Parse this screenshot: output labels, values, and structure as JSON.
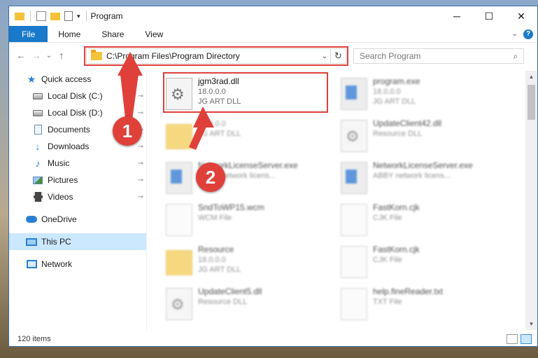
{
  "window": {
    "title": "Program",
    "controls": {
      "minimize": "─",
      "maximize": "☐",
      "close": "✕"
    }
  },
  "ribbon": {
    "tabs": [
      "File",
      "Home",
      "Share",
      "View"
    ],
    "expand_icon": "chevron-down-icon",
    "help_label": "?"
  },
  "navigation": {
    "back": "←",
    "forward": "→",
    "recent": "⌄",
    "up": "↑",
    "address": "C:\\Program Files\\Program Directory",
    "refresh": "↻",
    "dropdown": "⌄",
    "search_placeholder": "Search Program",
    "search_icon": "⌕"
  },
  "sidebar": {
    "items": [
      {
        "label": "Quick access",
        "icon": "star-icon",
        "pinned": false
      },
      {
        "label": "Local Disk (C:)",
        "icon": "disk-icon",
        "pinned": true
      },
      {
        "label": "Local Disk (D:)",
        "icon": "disk-icon",
        "pinned": true
      },
      {
        "label": "Documents",
        "icon": "documents-icon",
        "pinned": true
      },
      {
        "label": "Downloads",
        "icon": "downloads-icon",
        "pinned": true
      },
      {
        "label": "Music",
        "icon": "music-icon",
        "pinned": true
      },
      {
        "label": "Pictures",
        "icon": "pictures-icon",
        "pinned": true
      },
      {
        "label": "Videos",
        "icon": "videos-icon",
        "pinned": true
      },
      {
        "label": "OneDrive",
        "icon": "onedrive-icon",
        "pinned": false
      },
      {
        "label": "This PC",
        "icon": "this-pc-icon",
        "pinned": false,
        "selected": true
      },
      {
        "label": "Network",
        "icon": "network-icon",
        "pinned": false
      }
    ],
    "pin_glyph": "📌"
  },
  "files": [
    {
      "name": "jgm3rad.dll",
      "line2": "18.0.0.0",
      "line3": "JG ART DLL",
      "icon": "dll"
    },
    {
      "name": "program.exe",
      "line2": "18.0.0.0",
      "line3": "JG ART DLL",
      "icon": "exe"
    },
    {
      "name": "",
      "line2": "18.0.0.0",
      "line3": "JG ART DLL",
      "icon": "folder"
    },
    {
      "name": "UpdateClient42.dll",
      "line2": "Resource DLL",
      "line3": "",
      "icon": "dll"
    },
    {
      "name": "NetworkLicenseServer.exe",
      "line2": "ABBY network licens...",
      "line3": "",
      "icon": "exe"
    },
    {
      "name": "NetworkLicenseServer.exe",
      "line2": "ABBY network licens...",
      "line3": "",
      "icon": "exe"
    },
    {
      "name": "SndToWP15.wcm",
      "line2": "WCM File",
      "line3": "",
      "icon": "page"
    },
    {
      "name": "FastKorn.cjk",
      "line2": "CJK File",
      "line3": "",
      "icon": "page"
    },
    {
      "name": "Resource",
      "line2": "18.0.0.0",
      "line3": "JG ART DLL",
      "icon": "folder"
    },
    {
      "name": "FastKorn.cjk",
      "line2": "CJK File",
      "line3": "",
      "icon": "page"
    },
    {
      "name": "UpdateClient5.dll",
      "line2": "Resource DLL",
      "line3": "",
      "icon": "dll"
    },
    {
      "name": "help.fineReader.txt",
      "line2": "TXT File",
      "line3": "",
      "icon": "page"
    }
  ],
  "status": {
    "item_count": "120 items"
  },
  "callouts": {
    "step1": "1",
    "step2": "2",
    "color": "#e0403a"
  },
  "colors": {
    "accent": "#1979ca",
    "selection": "#cce8ff",
    "highlight": "#e0403a"
  }
}
